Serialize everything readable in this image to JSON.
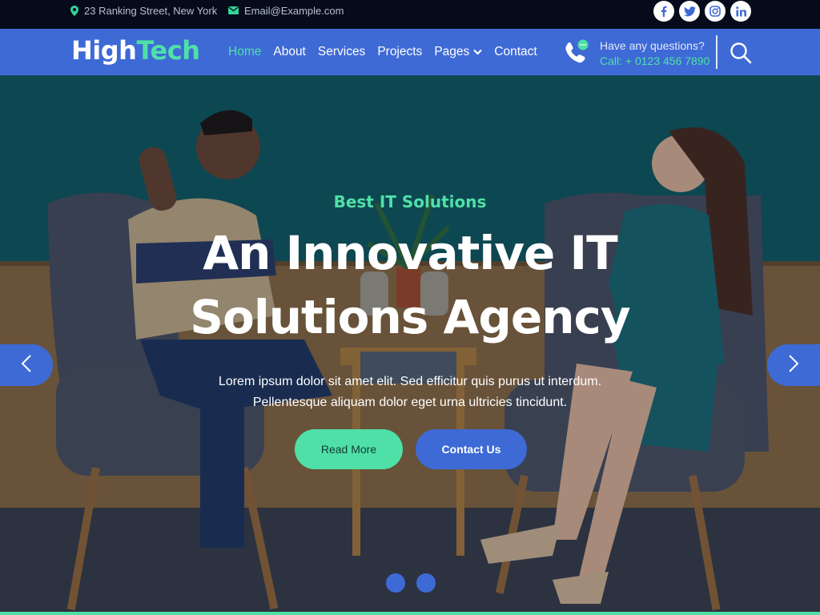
{
  "topbar": {
    "address": "23 Ranking Street, New York",
    "email": "Email@Example.com",
    "address_icon": "map-marker-icon",
    "email_icon": "envelope-icon",
    "socials": [
      "facebook-icon",
      "twitter-icon",
      "instagram-icon",
      "linkedin-icon"
    ]
  },
  "navbar": {
    "logo_part1": "High",
    "logo_part2": "Tech",
    "menu": [
      {
        "label": "Home",
        "active": true
      },
      {
        "label": "About",
        "active": false
      },
      {
        "label": "Services",
        "active": false
      },
      {
        "label": "Projects",
        "active": false
      },
      {
        "label": "Pages",
        "active": false,
        "dropdown": true
      },
      {
        "label": "Contact",
        "active": false
      }
    ],
    "call_question": "Have any questions?",
    "call_number": "Call: + 0123 456 7890"
  },
  "hero": {
    "subtitle": "Best IT Solutions",
    "headline": "An Innovative IT Solutions Agency",
    "description_line1": "Lorem ipsum dolor sit amet elit. Sed efficitur quis purus ut interdum.",
    "description_line2": "Pellentesque aliquam dolor eget urna ultricies tincidunt.",
    "read_more": "Read More",
    "contact_us": "Contact Us"
  },
  "colors": {
    "brand_blue": "#3e6ad6",
    "accent_green": "#4fe0a7",
    "topbar_bg": "#050b1a"
  }
}
